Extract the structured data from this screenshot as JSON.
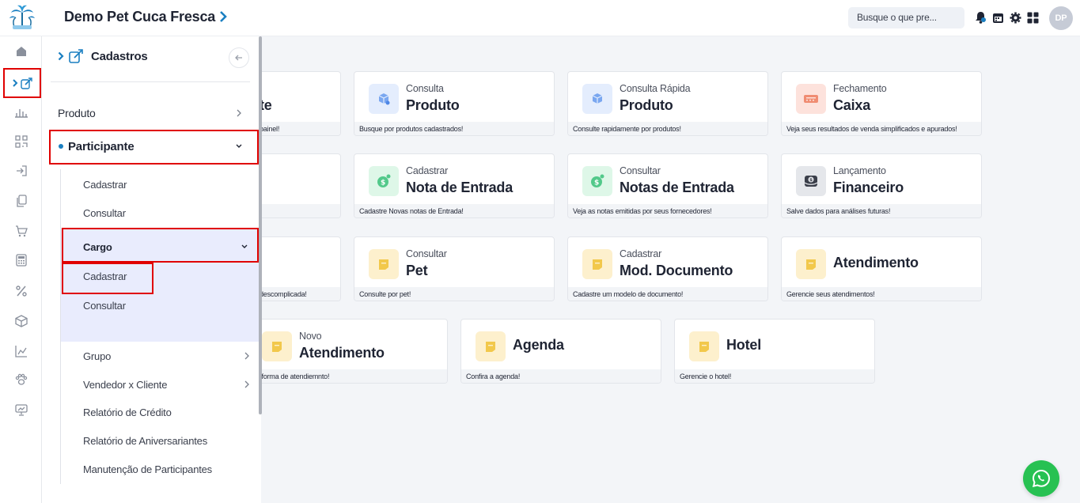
{
  "header": {
    "app_title": "Demo Pet Cuca Fresca",
    "search_placeholder": "Busque o que pre...",
    "avatar_initials": "DP"
  },
  "rail": {
    "icons": [
      "home-icon",
      "edit-icon",
      "chart-bar-icon",
      "scan-icon",
      "login-icon",
      "copy-icon",
      "cart-icon",
      "calculator-icon",
      "percent-icon",
      "box-icon",
      "chart-line-icon",
      "paw-icon",
      "presentation-icon"
    ]
  },
  "panel": {
    "title": "Cadastros",
    "items": {
      "produto": "Produto",
      "participante": "Participante",
      "cadastrar": "Cadastrar",
      "consultar": "Consultar",
      "cargo": "Cargo",
      "cargo_cadastrar": "Cadastrar",
      "cargo_consultar": "Consultar",
      "grupo": "Grupo",
      "vendedor_cliente": "Vendedor x Cliente",
      "relatorio_credito": "Relatório de Crédito",
      "relatorio_aniversariantes": "Relatório de Aniversariantes",
      "manutencao": "Manutenção de Participantes"
    }
  },
  "cards": {
    "c1": {
      "sup": "",
      "main": "te",
      "foot": "painel!"
    },
    "c2": {
      "sup": "Consulta",
      "main": "Produto",
      "foot": "Busque por produtos cadastrados!"
    },
    "c3": {
      "sup": "Consulta Rápida",
      "main": "Produto",
      "foot": "Consulte rapidamente por produtos!"
    },
    "c4": {
      "sup": "Fechamento",
      "main": "Caixa",
      "foot": "Veja seus resultados de venda simplificados e apurados!"
    },
    "c5": {
      "sup": "Cadastrar",
      "main": "Nota de Entrada",
      "foot": "Cadastre Novas notas de Entrada!"
    },
    "c6": {
      "sup": "Consultar",
      "main": "Notas de Entrada",
      "foot": "Veja as notas emitidas por seus fornecedores!"
    },
    "c7": {
      "sup": "Lançamento",
      "main": "Financeiro",
      "foot": "Salve dados para análises futuras!"
    },
    "c8": {
      "foot": "descomplicada!"
    },
    "c9": {
      "sup": "Consultar",
      "main": "Pet",
      "foot": "Consulte por pet!"
    },
    "c10": {
      "sup": "Cadastrar",
      "main": "Mod. Documento",
      "foot": "Cadastre um modelo de documento!"
    },
    "c11": {
      "main": "Atendimento",
      "foot": "Gerencie seus atendimentos!"
    },
    "c12": {
      "sup": "Novo",
      "main": "Atendimento",
      "foot": "va forma de atendiemnto!"
    },
    "c13": {
      "main": "Agenda",
      "foot": "Confira a agenda!"
    },
    "c14": {
      "main": "Hotel",
      "foot": "Gerencie o hotel!"
    }
  },
  "colors": {
    "accent": "#1a7fc1",
    "highlight_border": "#e00000",
    "selected_bg": "#e9ecfd",
    "whatsapp": "#27c152"
  }
}
